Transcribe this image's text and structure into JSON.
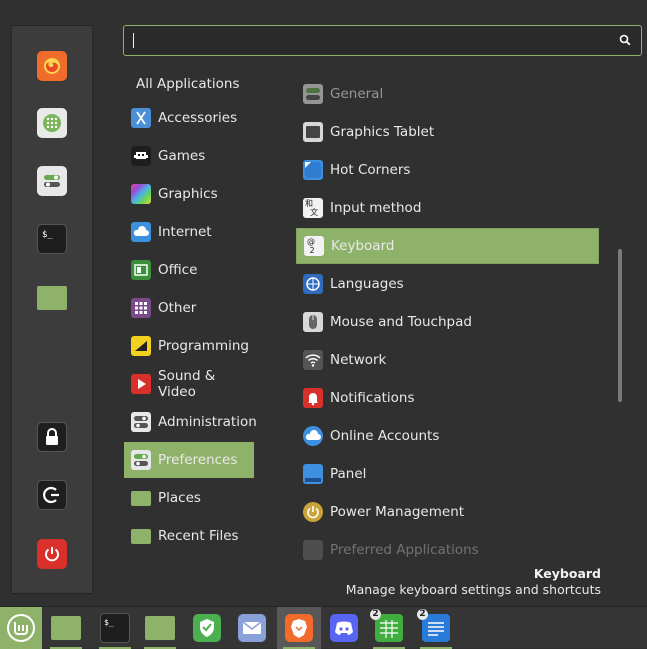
{
  "search": {
    "placeholder": ""
  },
  "favorites": [
    {
      "name": "firefox-icon"
    },
    {
      "name": "software-manager-icon"
    },
    {
      "name": "system-settings-icon"
    },
    {
      "name": "terminal-icon"
    },
    {
      "name": "files-icon"
    },
    {
      "name": "lock-screen-icon"
    },
    {
      "name": "logout-icon"
    },
    {
      "name": "shutdown-icon"
    }
  ],
  "categories": {
    "all": "All Applications",
    "items": [
      {
        "label": "Accessories"
      },
      {
        "label": "Games"
      },
      {
        "label": "Graphics"
      },
      {
        "label": "Internet"
      },
      {
        "label": "Office"
      },
      {
        "label": "Other"
      },
      {
        "label": "Programming"
      },
      {
        "label": "Sound & Video"
      },
      {
        "label": "Administration"
      },
      {
        "label": "Preferences"
      },
      {
        "label": "Places"
      },
      {
        "label": "Recent Files"
      }
    ],
    "selected": "Preferences"
  },
  "apps": {
    "items": [
      {
        "label": "General"
      },
      {
        "label": "Graphics Tablet"
      },
      {
        "label": "Hot Corners"
      },
      {
        "label": "Input method"
      },
      {
        "label": "Keyboard"
      },
      {
        "label": "Languages"
      },
      {
        "label": "Mouse and Touchpad"
      },
      {
        "label": "Network"
      },
      {
        "label": "Notifications"
      },
      {
        "label": "Online Accounts"
      },
      {
        "label": "Panel"
      },
      {
        "label": "Power Management"
      },
      {
        "label": "Preferred Applications"
      }
    ],
    "selected": "Keyboard"
  },
  "description": {
    "title": "Keyboard",
    "text": "Manage keyboard settings and shortcuts"
  },
  "taskbar": {
    "items": [
      {
        "name": "mint-menu-button"
      },
      {
        "name": "show-desktop-button"
      },
      {
        "name": "terminal-launcher"
      },
      {
        "name": "files-launcher"
      },
      {
        "name": "vpn-launcher"
      },
      {
        "name": "mail-launcher"
      },
      {
        "name": "brave-launcher"
      },
      {
        "name": "discord-launcher"
      },
      {
        "name": "spreadsheet-launcher",
        "badge": "2"
      },
      {
        "name": "text-editor-launcher",
        "badge": "2"
      }
    ]
  },
  "colors": {
    "accent": "#8fb26a",
    "panel": "#303030",
    "taskbar": "#353535"
  }
}
